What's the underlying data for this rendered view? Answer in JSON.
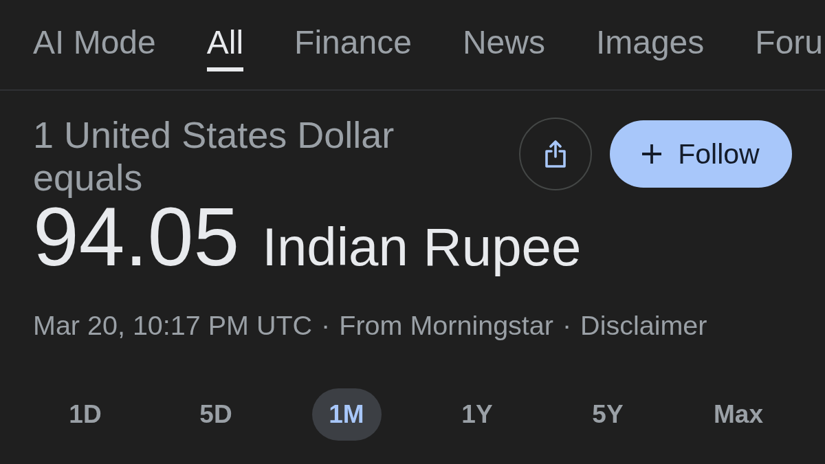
{
  "tabs": [
    {
      "label": "AI Mode",
      "selected": false
    },
    {
      "label": "All",
      "selected": true
    },
    {
      "label": "Finance",
      "selected": false
    },
    {
      "label": "News",
      "selected": false
    },
    {
      "label": "Images",
      "selected": false
    },
    {
      "label": "Foru",
      "selected": false
    }
  ],
  "conversion": {
    "from_text": "1 United States Dollar equals",
    "amount": "94.05",
    "currency": "Indian Rupee"
  },
  "actions": [
    {
      "kind": "share"
    },
    {
      "kind": "follow",
      "label": "Follow"
    }
  ],
  "meta": [
    {
      "kind": "text",
      "text": "Mar 20, 10:17 PM UTC"
    },
    {
      "kind": "separator",
      "text": "·"
    },
    {
      "kind": "text",
      "text": "From Morningstar"
    },
    {
      "kind": "separator",
      "text": "·"
    },
    {
      "kind": "link",
      "text": "Disclaimer"
    }
  ],
  "ranges": [
    {
      "label": "1D",
      "selected": false
    },
    {
      "label": "5D",
      "selected": false
    },
    {
      "label": "1M",
      "selected": true
    },
    {
      "label": "1Y",
      "selected": false
    },
    {
      "label": "5Y",
      "selected": false
    },
    {
      "label": "Max",
      "selected": false
    }
  ]
}
